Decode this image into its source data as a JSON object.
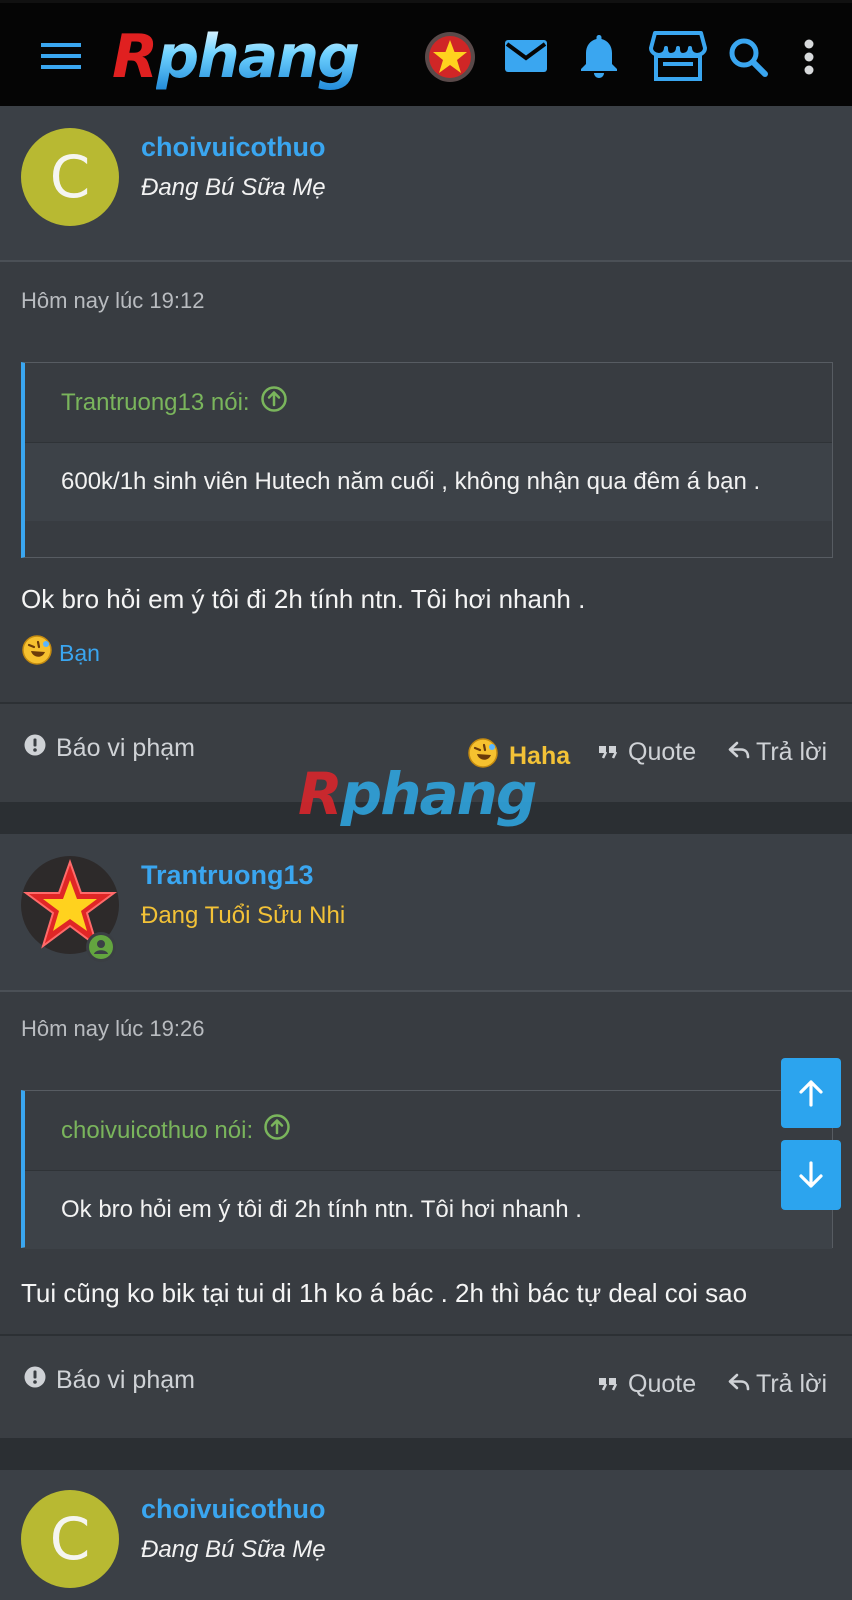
{
  "header": {
    "logo_text_red": "R",
    "logo_text_blue": "phang",
    "icons": [
      "menu-icon",
      "star-badge-icon",
      "mail-icon",
      "bell-icon",
      "store-icon",
      "search-icon",
      "more-icon"
    ]
  },
  "watermark": {
    "part1": "R",
    "part2": "phang"
  },
  "posts": [
    {
      "avatar_letter": "C",
      "username": "choivuicothuo",
      "user_title": "Đang Bú Sữa Mẹ",
      "timestamp": "Hôm nay lúc 19:12",
      "quote_author": "Trantruong13 nói:",
      "quote_text": "600k/1h sinh viên Hutech năm cuối , không nhận qua đêm á bạn .",
      "message": "Ok bro hỏi em ý tôi đi 2h tính ntn. Tôi hơi nhanh .",
      "reaction_user": "Bạn",
      "report_label": "Báo vi phạm",
      "reaction_label": "Haha",
      "quote_label": "Quote",
      "reply_label": "Trả lời"
    },
    {
      "username": "Trantruong13",
      "user_title": "Đang Tuổi Sửu Nhi",
      "timestamp": "Hôm nay lúc 19:26",
      "quote_author": "choivuicothuo nói:",
      "quote_text": "Ok bro hỏi em ý tôi đi 2h tính ntn. Tôi hơi nhanh .",
      "message": "Tui cũng ko bik tại tui di 1h ko á bác . 2h thì bác tự deal coi sao",
      "report_label": "Báo vi phạm",
      "quote_label": "Quote",
      "reply_label": "Trả lời"
    },
    {
      "avatar_letter": "C",
      "username": "choivuicothuo",
      "user_title": "Đang Bú Sữa Mẹ"
    }
  ],
  "colors": {
    "accent": "#3aa6f0",
    "quote_author": "#7ab55c",
    "title_gold": "#f3c237",
    "avatar_olive": "#b8b932"
  }
}
